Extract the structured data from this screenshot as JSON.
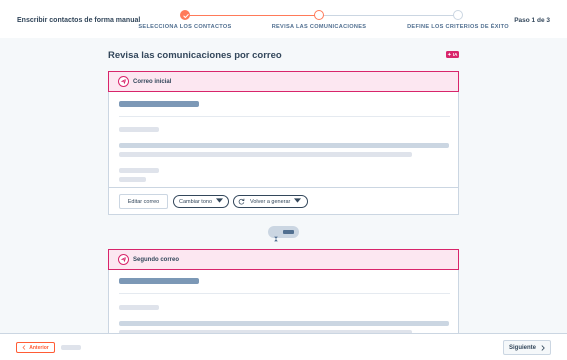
{
  "header": {
    "title": "Enscribir contactos de forma manual",
    "step_counter": "Paso 1 de 3",
    "steps": [
      {
        "label": "SELECCIONA LOS CONTACTOS",
        "state": "complete"
      },
      {
        "label": "REVISA LAS COMUNICACIONES",
        "state": "current"
      },
      {
        "label": "DEFINE LOS CRITERIOS DE ÉXITO",
        "state": "upcoming"
      }
    ]
  },
  "main": {
    "title": "Revisa las comunicaciones por correo",
    "ai_badge": "✦ IA",
    "emails": [
      {
        "label": "Correo inicial",
        "icon": "paper-plane-icon"
      },
      {
        "label": "Segundo correo",
        "icon": "paper-plane-icon"
      }
    ],
    "actions": {
      "edit": "Editar correo",
      "change_tone": "Cambiar tono",
      "regenerate": "Volver a generar"
    }
  },
  "footer": {
    "back": "Anterior",
    "next": "Siguiente"
  },
  "colors": {
    "accent": "#ff7a59",
    "ai_pink": "#d8256b",
    "card_head_bg": "#fce7f1",
    "text": "#33475b"
  }
}
